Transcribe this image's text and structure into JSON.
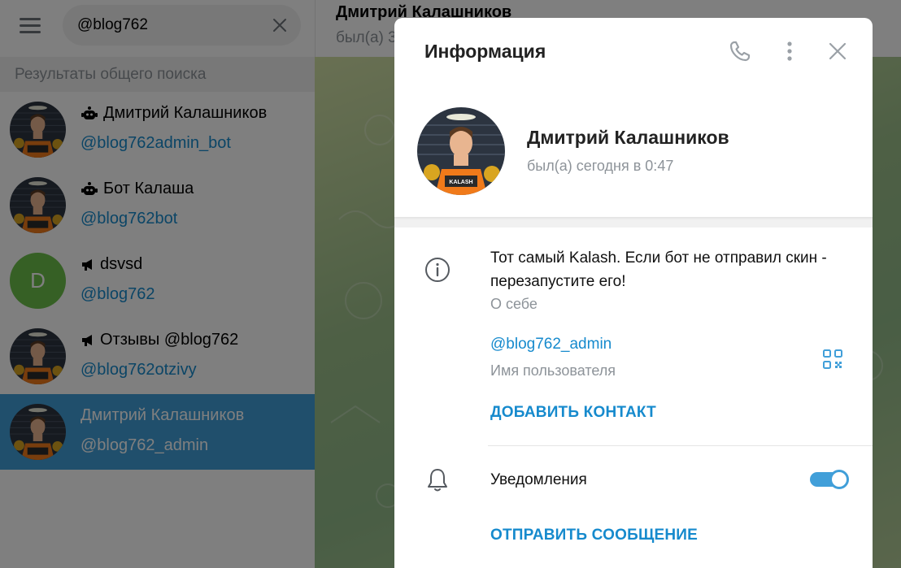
{
  "search": {
    "value": "@blog762"
  },
  "results_header": "Результаты общего поиска",
  "results": [
    {
      "prefix_icon": "bot-icon",
      "name": "Дмитрий Калашников",
      "username": "@blog762admin_bot",
      "avatar": "prisoner"
    },
    {
      "prefix_icon": "bot-icon",
      "name": "Бот Калаша",
      "username": "@blog762bot",
      "avatar": "prisoner"
    },
    {
      "prefix_icon": "channel-icon",
      "name": "dsvsd",
      "username": "@blog762",
      "avatar": "letter",
      "avatar_letter": "D"
    },
    {
      "prefix_icon": "channel-icon",
      "name": "Отзывы @blog762",
      "username": "@blog762otzivy",
      "avatar": "prisoner"
    },
    {
      "prefix_icon": "",
      "name": "Дмитрий Калашников",
      "username": "@blog762_admin",
      "avatar": "prisoner",
      "active": true
    }
  ],
  "chat": {
    "title": "Дмитрий Калашников",
    "status": "был(а) 3"
  },
  "modal": {
    "title": "Информация",
    "profile": {
      "name": "Дмитрий Калашников",
      "status": "был(а) сегодня в 0:47",
      "avatar_badge": "KALASH"
    },
    "bio": {
      "text": "Тот самый Kalash. Если бот не отправил скин - перезапустите его!",
      "label": "О себе"
    },
    "username": {
      "value": "@blog762_admin",
      "label": "Имя пользователя"
    },
    "add_contact": "ДОБАВИТЬ КОНТАКТ",
    "notifications": {
      "label": "Уведомления",
      "enabled": true
    },
    "send_message": "ОТПРАВИТЬ СООБЩЕНИЕ"
  },
  "colors": {
    "accent": "#168acd",
    "active_row": "#419fd9",
    "letter_avatar": "#6cc04a"
  }
}
